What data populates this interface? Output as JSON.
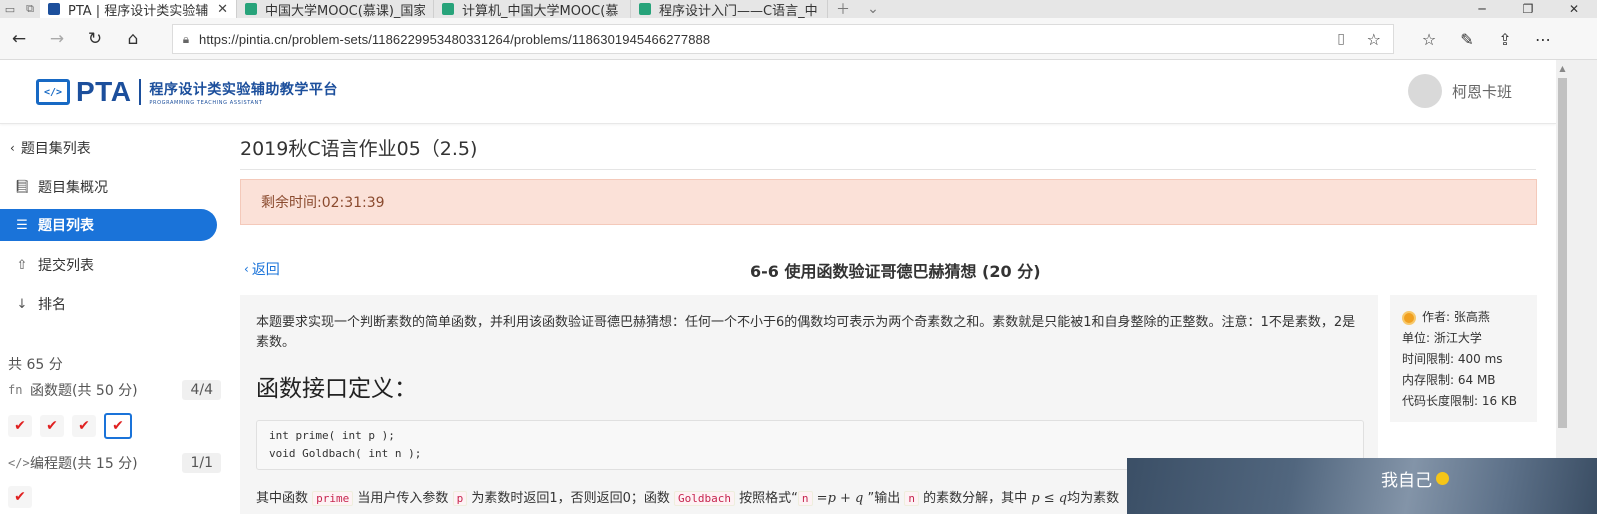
{
  "browser": {
    "tabs": [
      {
        "label": "PTA | 程序设计类实验辅",
        "active": true,
        "favicon_color": "#1c4f9c"
      },
      {
        "label": "中国大学MOOC(慕课)_国家",
        "active": false,
        "favicon_color": "#27a37a"
      },
      {
        "label": "计算机_中国大学MOOC(慕",
        "active": false,
        "favicon_color": "#27a37a"
      },
      {
        "label": "程序设计入门——C语言_中",
        "active": false,
        "favicon_color": "#27a37a"
      }
    ],
    "url": "https://pintia.cn/problem-sets/1186229953480331264/problems/1186301945466277888"
  },
  "header": {
    "logo_main": "PTA",
    "logo_cn": "程序设计类实验辅助教学平台",
    "logo_en": "PROGRAMMING TEACHING ASSISTANT",
    "user_name": "柯恩卡班"
  },
  "sidebar": {
    "back_label": "题目集列表",
    "items": [
      {
        "label": "题目集概况",
        "icon": "book-icon"
      },
      {
        "label": "题目列表",
        "icon": "list-icon",
        "active": true
      },
      {
        "label": "提交列表",
        "icon": "upload-icon"
      },
      {
        "label": "排名",
        "icon": "sort-icon"
      }
    ],
    "score_total": "共 65 分",
    "groups": [
      {
        "label": "函数题(共 50 分)",
        "icon": "fn",
        "count": "4/4",
        "checks": 4,
        "selected_index": 3
      },
      {
        "label": "编程题(共 15 分)",
        "icon": "</>",
        "count": "1/1",
        "checks": 1
      }
    ]
  },
  "main": {
    "set_title": "2019秋C语言作业05（2.5)",
    "timer": "剩余时间:02:31:39",
    "back": "返回",
    "problem_title": "6-6 使用函数验证哥德巴赫猜想 (20 分)",
    "description": "本题要求实现一个判断素数的简单函数，并利用该函数验证哥德巴赫猜想：任何一个不小于6的偶数均可表示为两个奇素数之和。素数就是只能被1和自身整除的正整数。注意：1不是素数，2是素数。",
    "heading": "函数接口定义：",
    "code_lines": [
      "int prime( int p );",
      "void Goldbach( int n );"
    ],
    "after": {
      "t1": "其中函数",
      "c1": "prime",
      "t2": "当用户传入参数",
      "c2": "p",
      "t3": "为素数时返回1，否则返回0；函数",
      "c3": "Goldbach",
      "t4": "按照格式“",
      "c4": "n",
      "m1": "=p + q",
      "t5": "”输出",
      "c5": "n",
      "t6": "的素数分解，其中",
      "m2": "p ≤ q",
      "t7": "均为素数"
    }
  },
  "info": {
    "author": "作者: 张高燕",
    "unit": "单位: 浙江大学",
    "time_limit": "时间限制: 400 ms",
    "memory_limit": "内存限制: 64 MB",
    "code_limit": "代码长度限制: 16 KB"
  },
  "float_widget": {
    "label": "我自己"
  }
}
